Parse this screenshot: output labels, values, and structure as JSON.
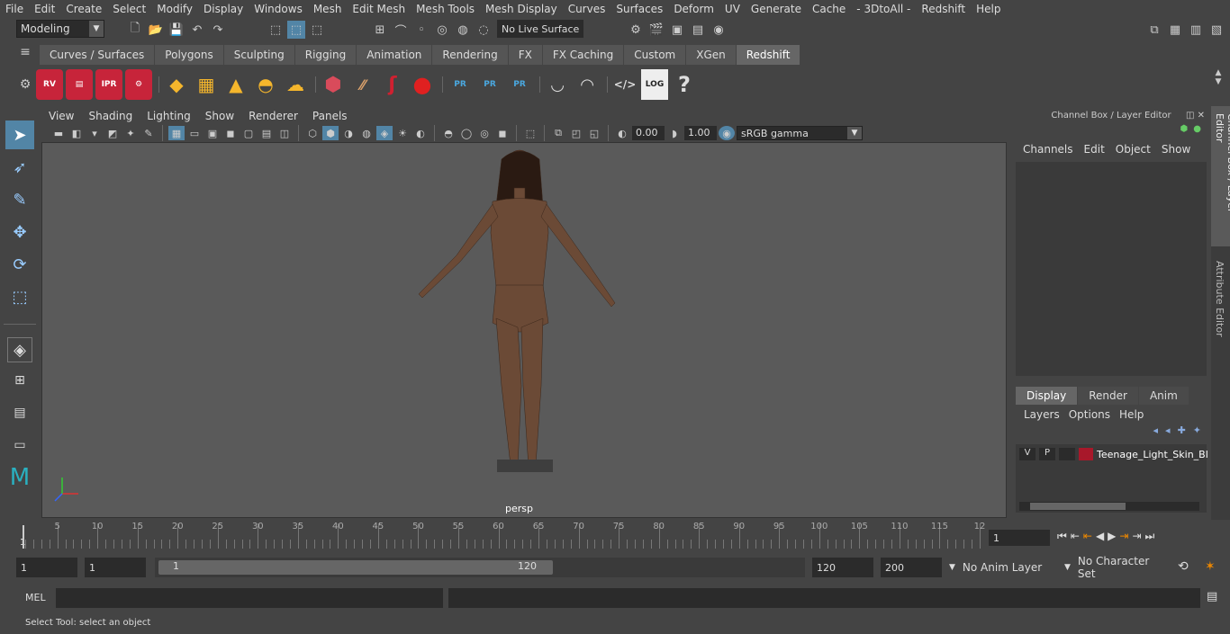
{
  "menu": [
    "File",
    "Edit",
    "Create",
    "Select",
    "Modify",
    "Display",
    "Windows",
    "Mesh",
    "Edit Mesh",
    "Mesh Tools",
    "Mesh Display",
    "Curves",
    "Surfaces",
    "Deform",
    "UV",
    "Generate",
    "Cache",
    "- 3DtoAll -",
    "Redshift",
    "Help"
  ],
  "toolbar": {
    "mode": "Modeling",
    "live_surface": "No Live Surface"
  },
  "shelf_tabs": [
    "Curves / Surfaces",
    "Polygons",
    "Sculpting",
    "Rigging",
    "Animation",
    "Rendering",
    "FX",
    "FX Caching",
    "Custom",
    "XGen",
    "Redshift"
  ],
  "active_shelf": "Redshift",
  "shelf_icons": {
    "rv": "RV",
    "ipr": "IPR",
    "pr": "PR",
    "log": "LOG",
    "help": "?"
  },
  "panel_menu": [
    "View",
    "Shading",
    "Lighting",
    "Show",
    "Renderer",
    "Panels"
  ],
  "panel_toolbar": {
    "exposure": "0.00",
    "gamma": "1.00",
    "colorspace": "sRGB gamma"
  },
  "viewport": {
    "camera_label": "persp"
  },
  "channel_box": {
    "title": "Channel Box / Layer Editor",
    "menu": [
      "Channels",
      "Edit",
      "Object",
      "Show"
    ],
    "layer_tabs": [
      "Display",
      "Render",
      "Anim"
    ],
    "layer_menu": [
      "Layers",
      "Options",
      "Help"
    ],
    "layer": {
      "v": "V",
      "p": "P",
      "name": "Teenage_Light_Skin_Bl",
      "color": "#a8182a"
    }
  },
  "side_tabs": {
    "channel": "Channel Box / Layer Editor",
    "attribute": "Attribute Editor"
  },
  "timeline": {
    "ticks": [
      "5",
      "10",
      "15",
      "20",
      "25",
      "30",
      "35",
      "40",
      "45",
      "50",
      "55",
      "60",
      "65",
      "70",
      "75",
      "80",
      "85",
      "90",
      "95",
      "100",
      "105",
      "110",
      "115",
      "12"
    ],
    "start_label": "1",
    "current_frame": "1"
  },
  "range": {
    "start": "1",
    "start2": "1",
    "slider_start": "1",
    "slider_end": "120",
    "end": "120",
    "end2": "200",
    "anim_layer": "No Anim Layer",
    "char_set": "No Character Set"
  },
  "cmd": {
    "label": "MEL"
  },
  "status": {
    "text": "Select Tool: select an object"
  }
}
